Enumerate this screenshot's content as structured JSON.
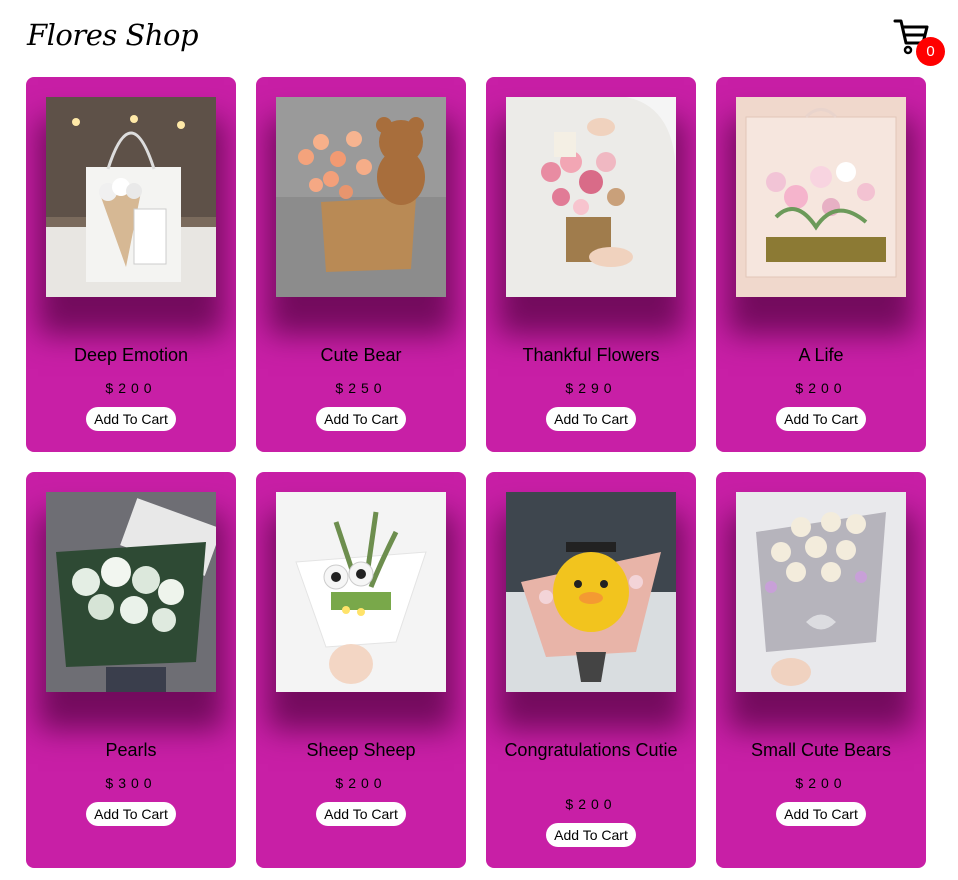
{
  "header": {
    "logo": "Flores Shop",
    "cart_icon": "shopping-cart-icon",
    "cart_count": "0"
  },
  "products": [
    {
      "name": "Deep Emotion",
      "price": "$200",
      "button": "Add To Cart",
      "image": "bouquet-gift-bag-image"
    },
    {
      "name": "Cute Bear",
      "price": "$250",
      "button": "Add To Cart",
      "image": "teddy-bear-flower-bag-image"
    },
    {
      "name": "Thankful Flowers",
      "price": "$290",
      "button": "Add To Cart",
      "image": "flower-basket-image"
    },
    {
      "name": "A Life",
      "price": "$200",
      "button": "Add To Cart",
      "image": "flower-box-image"
    },
    {
      "name": "Pearls",
      "price": "$300",
      "button": "Add To Cart",
      "image": "white-bouquet-image"
    },
    {
      "name": "Sheep Sheep",
      "price": "$200",
      "button": "Add To Cart",
      "image": "sheep-bouquet-image"
    },
    {
      "name": "Congratulations Cutie",
      "price": "$200",
      "button": "Add To Cart",
      "image": "graduation-duck-bouquet-image"
    },
    {
      "name": "Small Cute Bears",
      "price": "$200",
      "button": "Add To Cart",
      "image": "small-bears-bouquet-image"
    }
  ],
  "colors": {
    "card": "#c81fa6",
    "badge": "#ff0000",
    "button": "#ffffff"
  }
}
